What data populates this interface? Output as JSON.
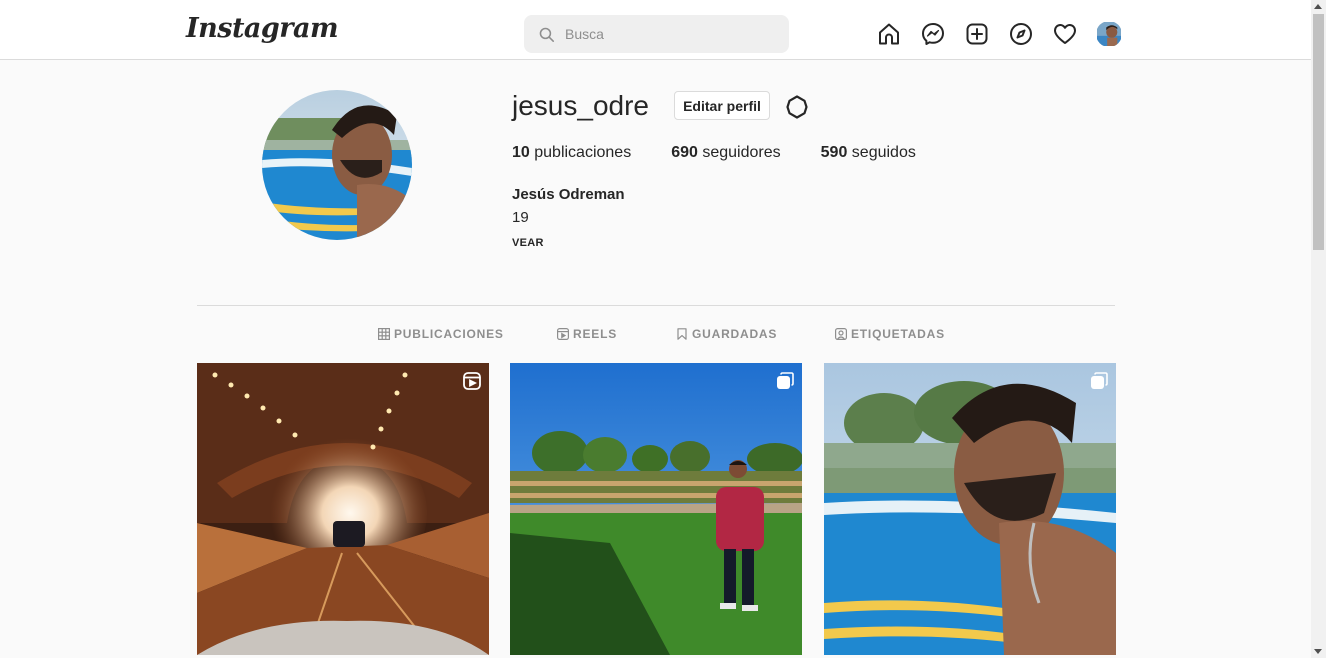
{
  "nav": {
    "logo": "Instagram",
    "search_placeholder": "Busca",
    "icons": [
      "home-icon",
      "messenger-icon",
      "new-post-icon",
      "explore-icon",
      "activity-heart-icon",
      "profile-avatar"
    ]
  },
  "profile": {
    "username": "jesus_odre",
    "edit_button": "Editar perfil",
    "stats": {
      "posts_count": "10",
      "posts_label": "publicaciones",
      "followers_count": "690",
      "followers_label": "seguidores",
      "following_count": "590",
      "following_label": "seguidos"
    },
    "full_name": "Jesús Odreman",
    "bio_line1": "19",
    "bio_line2": "VEAR"
  },
  "tabs": [
    {
      "label": "PUBLICACIONES",
      "icon": "grid-icon"
    },
    {
      "label": "REELS",
      "icon": "reels-icon"
    },
    {
      "label": "GUARDADAS",
      "icon": "bookmark-icon"
    },
    {
      "label": "ETIQUETADAS",
      "icon": "tagged-icon"
    }
  ],
  "posts": [
    {
      "badge": "reel-icon"
    },
    {
      "badge": "carousel-icon"
    },
    {
      "badge": "carousel-icon"
    }
  ],
  "colors": {
    "border": "#dbdbdb",
    "text": "#262626",
    "muted": "#8e8e8e",
    "background": "#fafafa"
  }
}
